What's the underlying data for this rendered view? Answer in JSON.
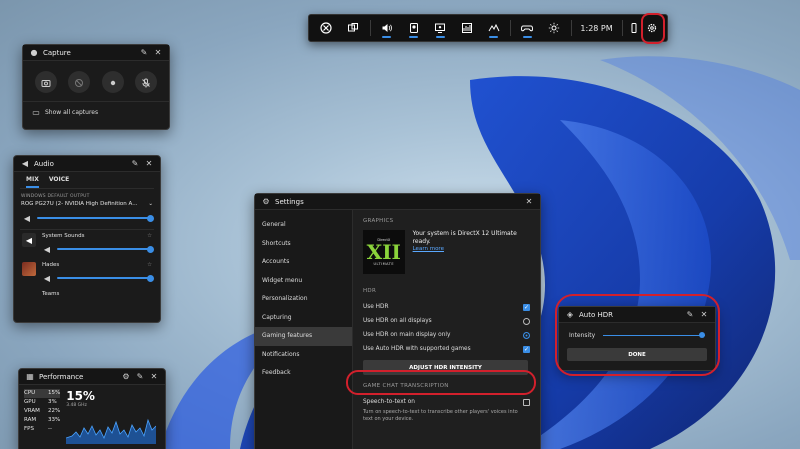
{
  "gamebar": {
    "time": "1:28 PM",
    "items": [
      {
        "icon": "xbox-icon",
        "active": false
      },
      {
        "icon": "widgets-icon",
        "active": false
      },
      {
        "icon": "audio-icon",
        "active": true
      },
      {
        "icon": "capture-icon",
        "active": true
      },
      {
        "icon": "gallery-icon",
        "active": true
      },
      {
        "icon": "performance-icon",
        "active": false
      },
      {
        "icon": "social-icon",
        "active": true
      },
      {
        "icon": "controller-icon",
        "active": true
      },
      {
        "icon": "brightness-icon",
        "active": false
      }
    ]
  },
  "capture": {
    "title": "Capture",
    "footer": "Show all captures"
  },
  "audio": {
    "title": "Audio",
    "tabs": [
      "MIX",
      "VOICE"
    ],
    "output_heading": "WINDOWS DEFAULT OUTPUT",
    "device": "ROG PG27U (2- NVIDIA High Definition A...",
    "apps": [
      {
        "name": "System Sounds"
      },
      {
        "name": "Hades"
      },
      {
        "name": "Teams"
      }
    ]
  },
  "performance": {
    "title": "Performance",
    "stats": [
      {
        "label": "CPU",
        "value": "15%"
      },
      {
        "label": "GPU",
        "value": "3%"
      },
      {
        "label": "VRAM",
        "value": "22%"
      },
      {
        "label": "RAM",
        "value": "33%"
      },
      {
        "label": "FPS",
        "value": "--"
      }
    ],
    "big_value": "15%",
    "sub_value": "3.48 GHz"
  },
  "settings": {
    "title": "Settings",
    "nav": [
      "General",
      "Shortcuts",
      "Accounts",
      "Widget menu",
      "Personalization",
      "Capturing",
      "Gaming features",
      "Notifications",
      "Feedback"
    ],
    "active_nav": "Gaming features",
    "graphics_heading": "GRAPHICS",
    "dx_logo_top": "DirectX",
    "dx_logo_main": "XII",
    "dx_logo_bottom": "ULTIMATE",
    "dx_text": "Your system is DirectX 12 Ultimate ready.",
    "dx_link": "Learn more",
    "hdr_heading": "HDR",
    "options": [
      {
        "label": "Use HDR",
        "control": "checkbox",
        "checked": true
      },
      {
        "label": "Use HDR on all displays",
        "control": "radio",
        "checked": false
      },
      {
        "label": "Use HDR on main display only",
        "control": "radio",
        "checked": true
      },
      {
        "label": "Use Auto HDR with supported games",
        "control": "checkbox",
        "checked": true
      }
    ],
    "hdr_button": "ADJUST HDR INTENSITY",
    "transcription_heading": "GAME CHAT TRANSCRIPTION",
    "stt_label": "Speech-to-text on",
    "stt_desc": "Turn on speech-to-text to transcribe other players' voices into text on your device."
  },
  "autohdr": {
    "title": "Auto HDR",
    "intensity_label": "Intensity",
    "intensity_value": 1.0,
    "done": "DONE"
  },
  "colors": {
    "accent": "#3a8ee6",
    "highlight": "#d2202c",
    "directx_green": "#8bd43b"
  }
}
